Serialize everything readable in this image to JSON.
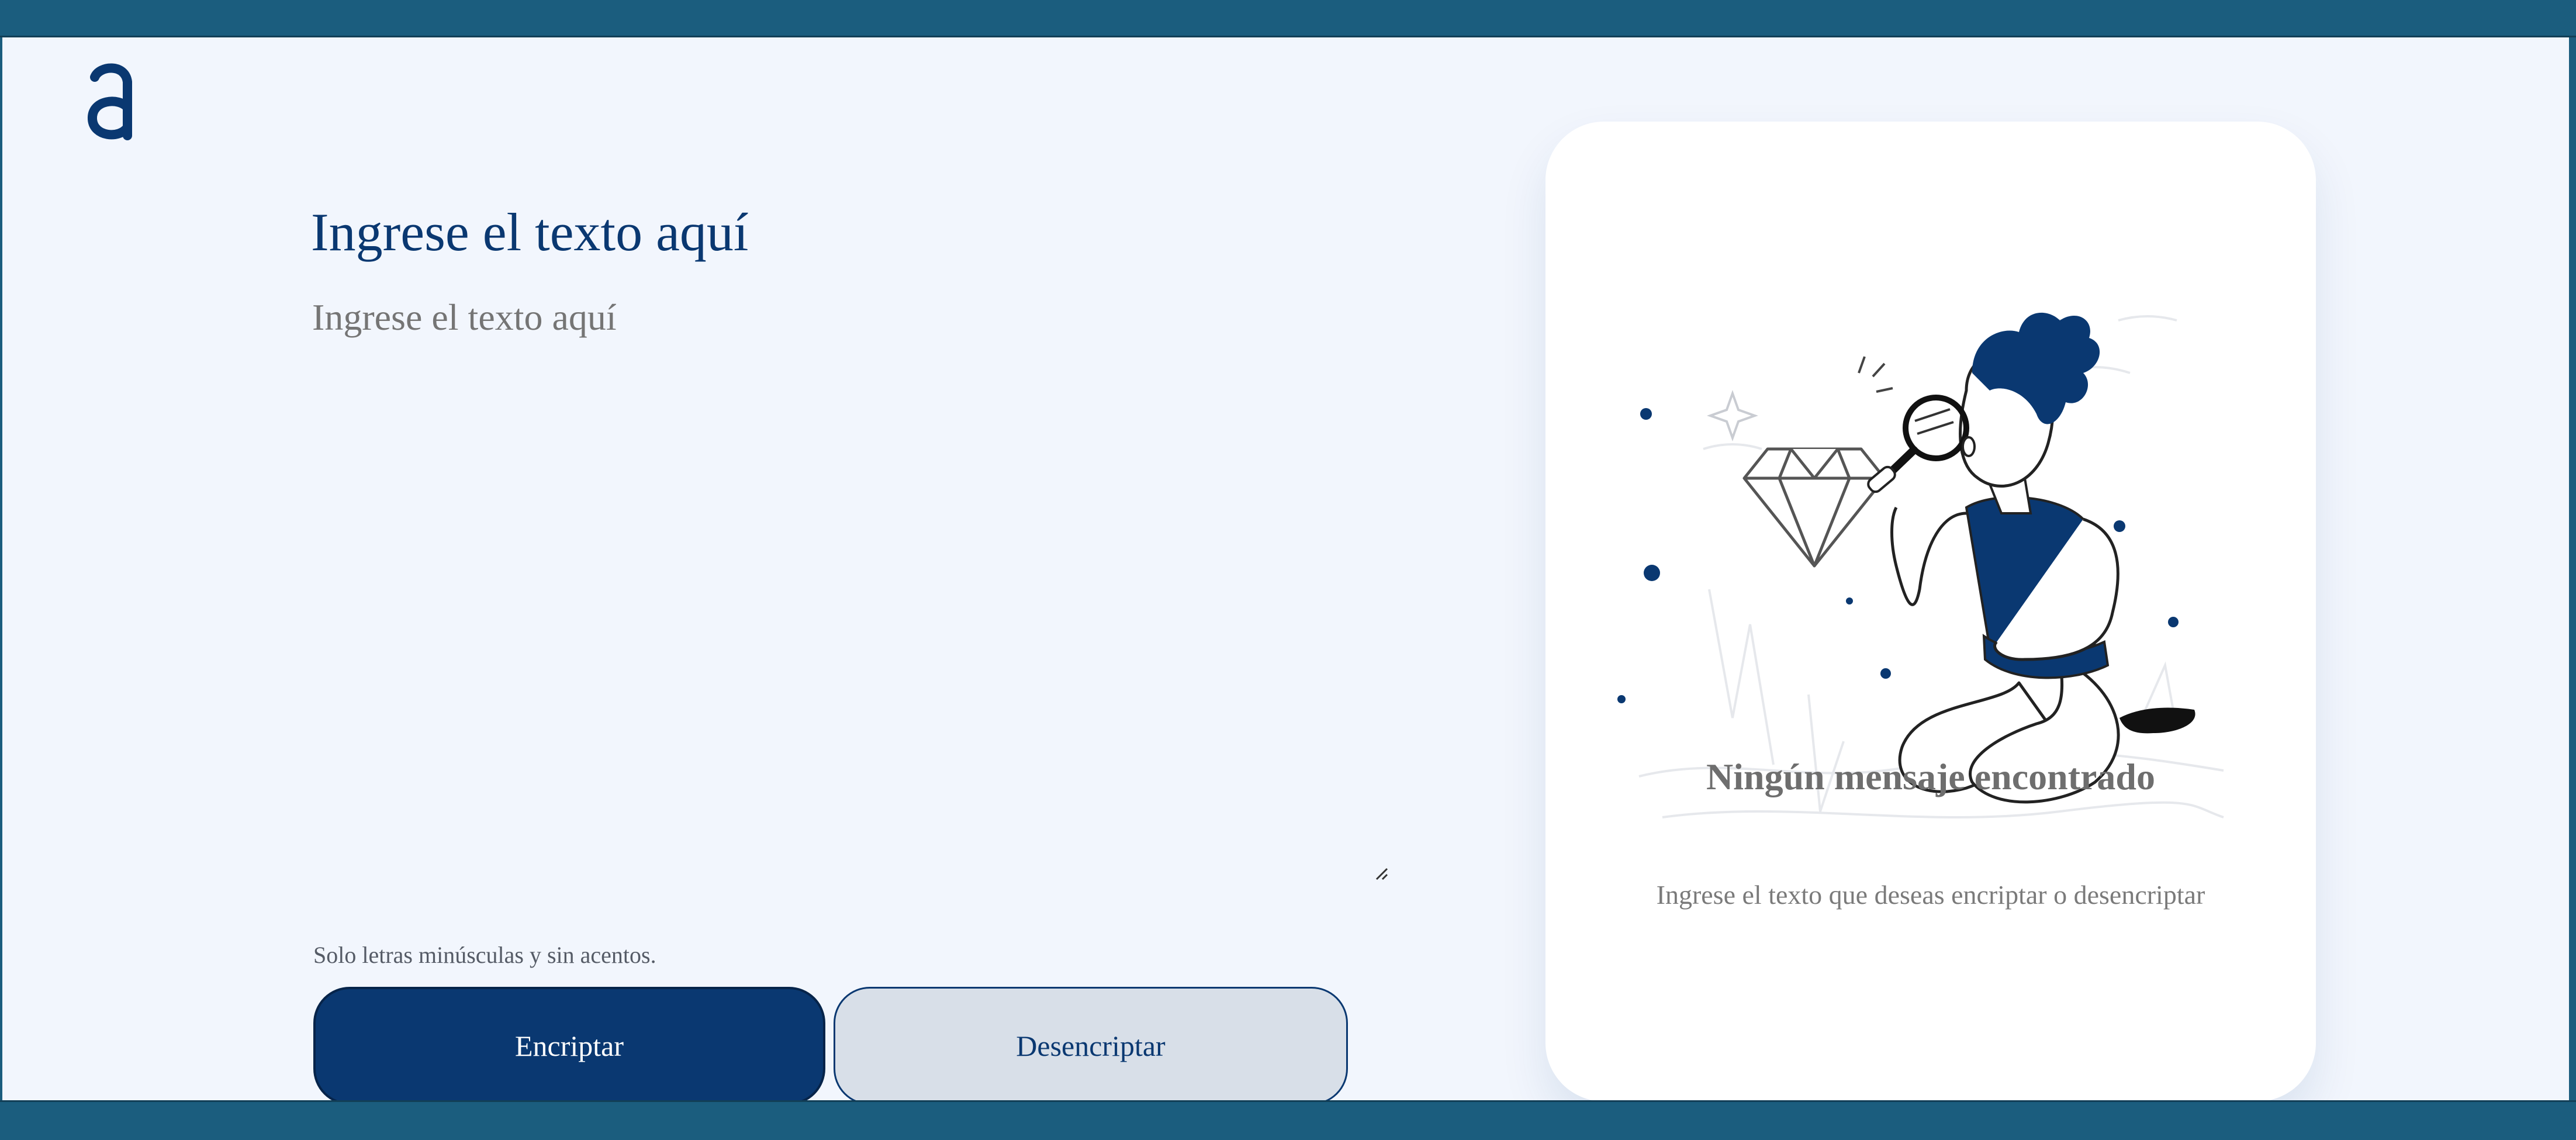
{
  "app": {
    "logo_letter": "a",
    "accent_color": "#0a3871",
    "frame_color": "#1b5d7e",
    "background_color": "#f2f6fd"
  },
  "input": {
    "title": "Ingrese el texto aquí",
    "value": "",
    "hint_icon": "info-icon",
    "hint": "Solo letras minúsculas y sin acentos."
  },
  "buttons": {
    "encrypt_label": "Encriptar",
    "decrypt_label": "Desencriptar"
  },
  "output": {
    "illustration": "person-with-magnifying-glass-and-diamond",
    "title": "Ningún mensaje encontrado",
    "subtitle": "Ingrese el texto que deseas encriptar o desencriptar"
  }
}
